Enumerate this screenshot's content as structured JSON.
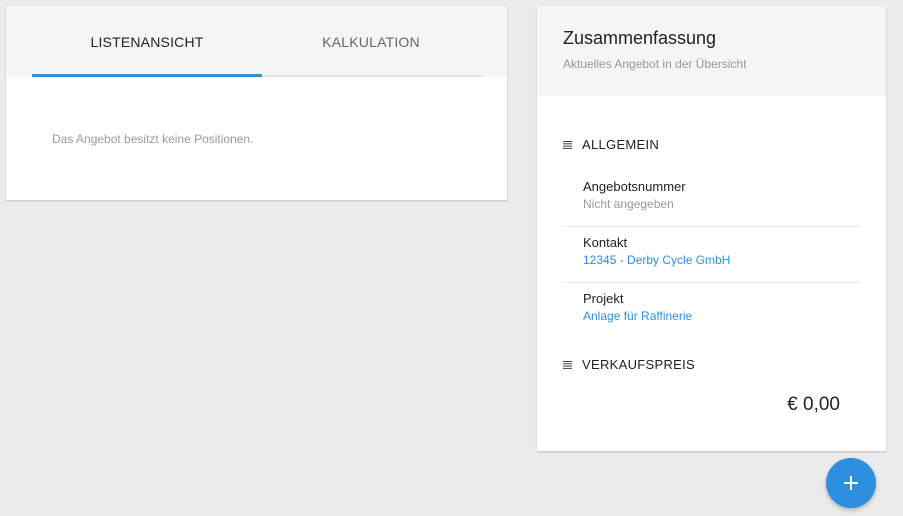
{
  "tabs": {
    "list_label": "LISTENANSICHT",
    "calc_label": "KALKULATION",
    "active": "LISTENANSICHT"
  },
  "list": {
    "empty_message": "Das Angebot besitzt keine Positionen."
  },
  "summary": {
    "title": "Zusammenfassung",
    "subtitle": "Aktuelles Angebot in der Übersicht",
    "general": {
      "heading": "ALLGEMEIN",
      "icon": "list-icon",
      "items": [
        {
          "label": "Angebotsnummer",
          "value": "Nicht angegeben"
        },
        {
          "label": "Kontakt",
          "value": "12345 - Derby Cycle GmbH"
        },
        {
          "label": "Projekt",
          "value": "Anlage für Raffinerie"
        }
      ]
    },
    "price": {
      "heading": "VERKAUFSPREIS",
      "icon": "list-icon",
      "value": "€ 0,00"
    }
  },
  "fab": {
    "icon": "plus-icon"
  },
  "colors": {
    "accent": "#2d8fe0",
    "background": "#ebebeb",
    "header_bg": "#f5f5f5"
  }
}
